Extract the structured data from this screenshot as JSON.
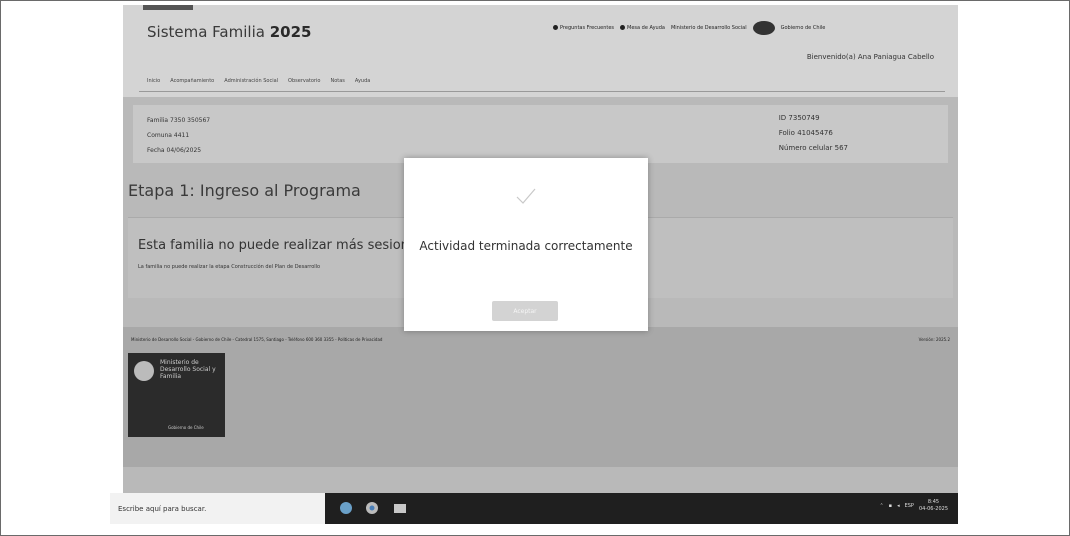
{
  "app": {
    "title_prefix": "Sistema Familia",
    "title_year": "2025"
  },
  "header": {
    "links": [
      "Preguntas Frecuentes",
      "Mesa de Ayuda",
      "Ministerio de Desarrollo Social",
      "Gobierno de Chile"
    ],
    "welcome": "Bienvenido(a) Ana Paniagua Cabello"
  },
  "menu": {
    "items": [
      "Inicio",
      "Acompañamiento",
      "Administración Social",
      "Observatorio",
      "Notas",
      "Ayuda"
    ]
  },
  "family_info": {
    "left": [
      "Familia 7350 350567",
      "Comuna 4411",
      "Fecha 04/06/2025"
    ],
    "right": [
      "ID 7350749",
      "Folio 41045476",
      "Número celular 567"
    ]
  },
  "stage": {
    "title": "Etapa 1: Ingreso al Programa"
  },
  "content": {
    "main_message": "Esta familia no puede realizar más sesion",
    "sub_message": "La familia no puede realizar la etapa Construcción del Plan de Desarrollo"
  },
  "footer": {
    "left_text": "Ministerio de Desarrollo Social - Gobierno de Chile - Catedral 1575, Santiago - Teléfono 600 360 3355 - Políticas de Privacidad",
    "right_text": "Versión: 2025.2",
    "ministry_name": "Ministerio de Desarrollo Social y Familia",
    "ministry_link": "Gobierno de Chile"
  },
  "taskbar": {
    "search_placeholder": "Escribe aquí para buscar.",
    "tray_lang": "ESP",
    "time": "8:45",
    "date": "04-06-2025"
  },
  "modal": {
    "icon": "check-icon",
    "title": "Actividad terminada correctamente",
    "button_label": "Aceptar"
  }
}
